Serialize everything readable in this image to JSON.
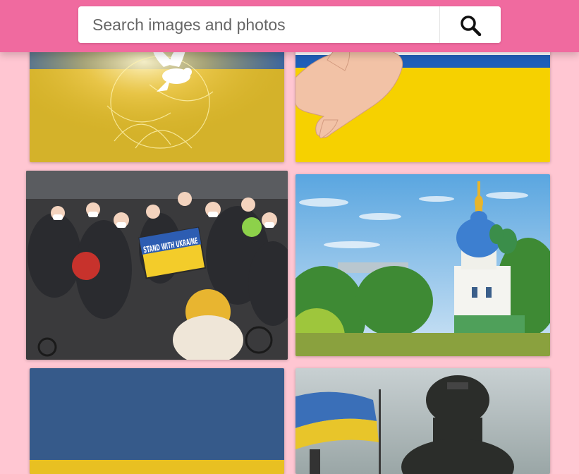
{
  "search": {
    "placeholder": "Search images and photos",
    "value": "",
    "button_icon": "search-icon"
  },
  "colors": {
    "header": "#f06a9f",
    "background": "#ffc6d2",
    "ukraine_blue": "#1f5fb8",
    "ukraine_yellow": "#f6d100"
  },
  "photos": [
    {
      "subject": "dove over ukrainian flag",
      "icon": "dove-icon"
    },
    {
      "subject": "holding hands over ukrainian flag",
      "icon": "hand-icon"
    },
    {
      "subject": "street protest crowd with sign",
      "icon": "crowd-photo",
      "sign_text": "STAND WITH UKRAINE"
    },
    {
      "subject": "kyiv monastery with blue domes",
      "icon": "church-photo"
    },
    {
      "subject": "painted ukrainian flag wall",
      "icon": "flag-wall"
    },
    {
      "subject": "soldier with ukrainian flag",
      "icon": "soldier-photo"
    }
  ]
}
